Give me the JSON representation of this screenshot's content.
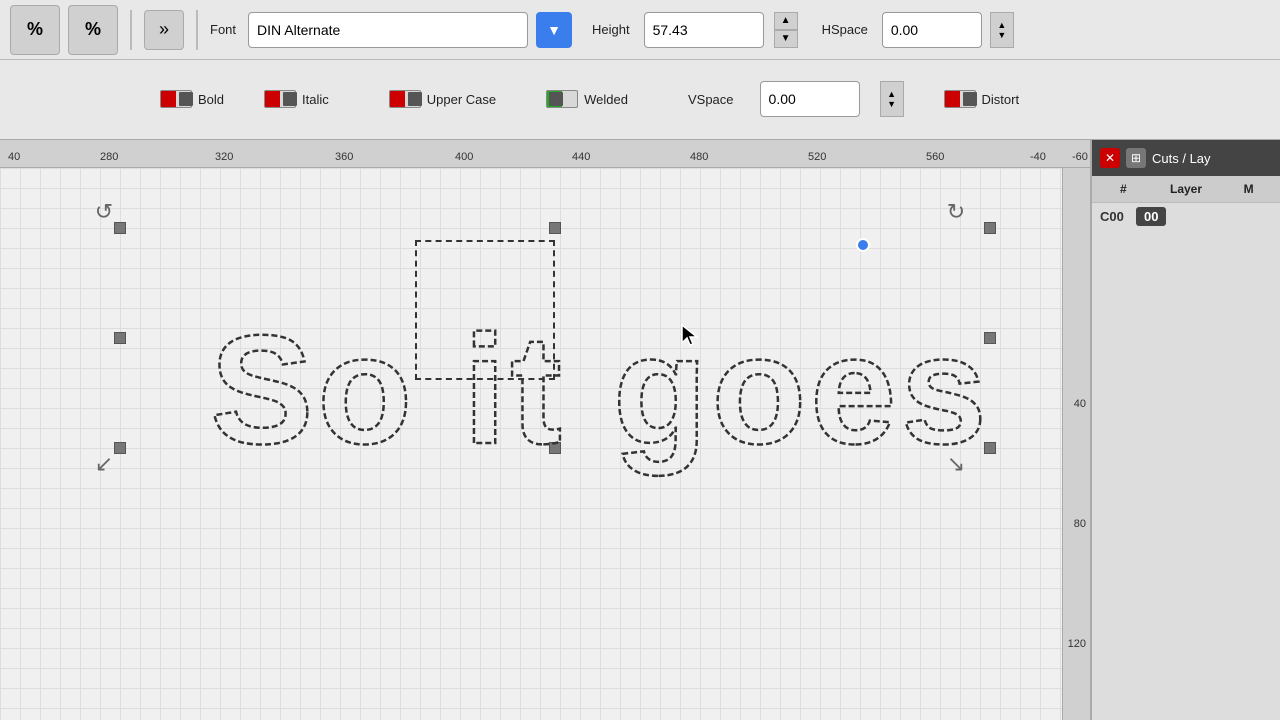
{
  "toolbar": {
    "pct1_label": "%",
    "pct2_label": "%",
    "arrows_label": "»",
    "font_label": "Font",
    "font_value": "DIN Alternate",
    "height_label": "Height",
    "height_value": "57.43",
    "hspace_label": "HSpace",
    "hspace_value": "0.00",
    "vspace_label": "VSpace",
    "vspace_value": "0.00",
    "bold_label": "Bold",
    "italic_label": "Italic",
    "uppercase_label": "Upper Case",
    "distort_label": "Distort",
    "welded_label": "Welded"
  },
  "ruler": {
    "marks": [
      "40",
      "280",
      "320",
      "360",
      "400",
      "440",
      "480",
      "520",
      "560",
      "-40",
      "-60"
    ],
    "right_marks": [
      "40",
      "80",
      "120"
    ]
  },
  "panel": {
    "title": "Cuts / Lay",
    "col_hash": "#",
    "col_layer": "Layer",
    "col_m": "M",
    "row_num": "C00",
    "row_badge": "00"
  },
  "canvas": {
    "text": "So it goes"
  }
}
